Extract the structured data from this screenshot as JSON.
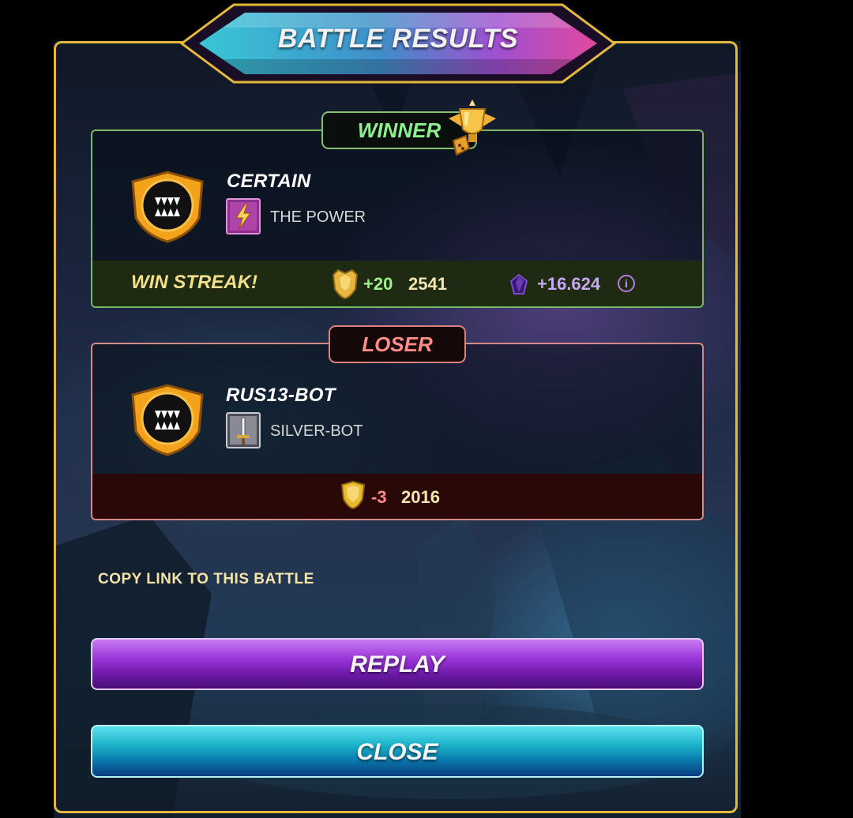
{
  "title": "BATTLE RESULTS",
  "winner": {
    "tag": "WINNER",
    "player_name": "CERTAIN",
    "guild_name": "THE POWER",
    "streak_label": "WIN STREAK!",
    "rating_change": "+20",
    "rating": "2541",
    "reward_change": "+16.624",
    "info_icon": "i"
  },
  "loser": {
    "tag": "LOSER",
    "player_name": "RUS13-BOT",
    "guild_name": "SILVER-BOT",
    "rating_change": "-3",
    "rating": "2016"
  },
  "copy_link_label": "COPY LINK TO THIS BATTLE",
  "buttons": {
    "replay": "REPLAY",
    "close": "CLOSE"
  },
  "colors": {
    "frame_gold": "#e2b93b",
    "winner_green": "#8ef08c",
    "loser_red": "#ff8b86",
    "reward_purple": "#c7a8f5",
    "replay_purple": "#9a34d8",
    "close_cyan": "#1fb6cc"
  },
  "icons": {
    "winner_badge": "fanged-maw-badge-icon",
    "loser_badge": "fanged-maw-badge-icon",
    "trophy": "winged-trophy-icon",
    "winner_guild": "lightning-banner-icon",
    "loser_guild": "sword-banner-icon",
    "rating": "gold-shield-icon",
    "reward": "dark-crystal-icon",
    "info": "info-icon"
  }
}
